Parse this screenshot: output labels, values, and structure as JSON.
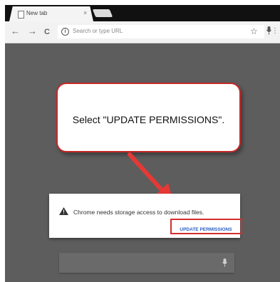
{
  "tab": {
    "title": "New tab",
    "close_glyph": "×"
  },
  "toolbar": {
    "back_glyph": "←",
    "forward_glyph": "→",
    "reload_glyph": "C",
    "omnibox_placeholder": "Search or type URL",
    "info_glyph": "i",
    "star_glyph": "☆",
    "menu_glyph": "⋮"
  },
  "callout": {
    "text": "Select \"UPDATE PERMISSIONS\"."
  },
  "dialog": {
    "message": "Chrome needs storage access to download files.",
    "button_label": "UPDATE PERMISSIONS"
  },
  "colors": {
    "accent_red": "#d32f2f",
    "link_blue": "#2a5ec0",
    "page_background": "#5d5d5d"
  },
  "icons": [
    "page-icon",
    "back-arrow-icon",
    "forward-arrow-icon",
    "reload-icon",
    "info-icon",
    "star-icon",
    "microphone-icon",
    "menu-icon",
    "warning-icon",
    "pointer-arrow-icon"
  ]
}
